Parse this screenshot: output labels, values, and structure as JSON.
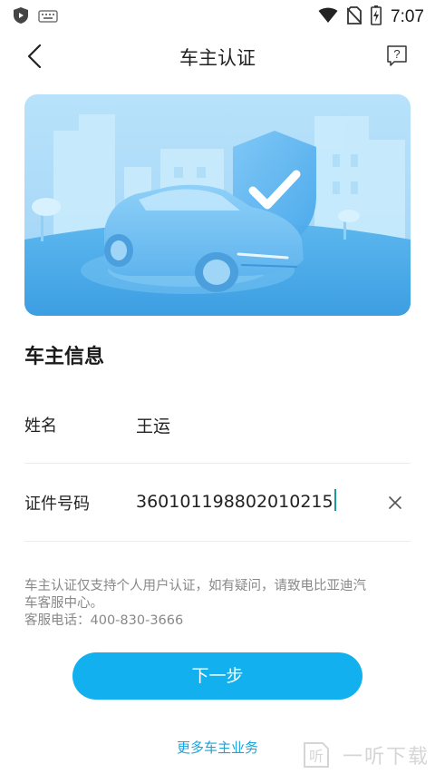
{
  "status_bar": {
    "time": "7:07",
    "icons": [
      "shield-app-icon",
      "keyboard-icon",
      "wifi-icon",
      "no-sim-icon",
      "battery-charging-icon"
    ]
  },
  "header": {
    "title": "车主认证",
    "back_icon": "chevron-left-icon",
    "help_icon": "help-chat-icon",
    "help_glyph": "?"
  },
  "banner": {
    "illustration": "car-with-shield-check",
    "colors": {
      "sky": "#a8d8f8",
      "ground": "#4aa8e8",
      "car": "#7cc4f4",
      "shield": "#5ab0ee"
    }
  },
  "owner_info": {
    "section_title": "车主信息",
    "name_label": "姓名",
    "name_value": "王运",
    "id_label": "证件号码",
    "id_value": "360101198802010215"
  },
  "notice": {
    "line1": "车主认证仅支持个人用户认证，如有疑问，请致电比亚迪汽",
    "line2": "车客服中心。",
    "line3": "客服电话：400-830-3666"
  },
  "actions": {
    "next_label": "下一步",
    "more_link": "更多车主业务"
  },
  "watermark": {
    "logo_char": "听",
    "text": "一听下载"
  },
  "theme": {
    "accent": "#12b0ef",
    "link": "#1aa3dc"
  }
}
